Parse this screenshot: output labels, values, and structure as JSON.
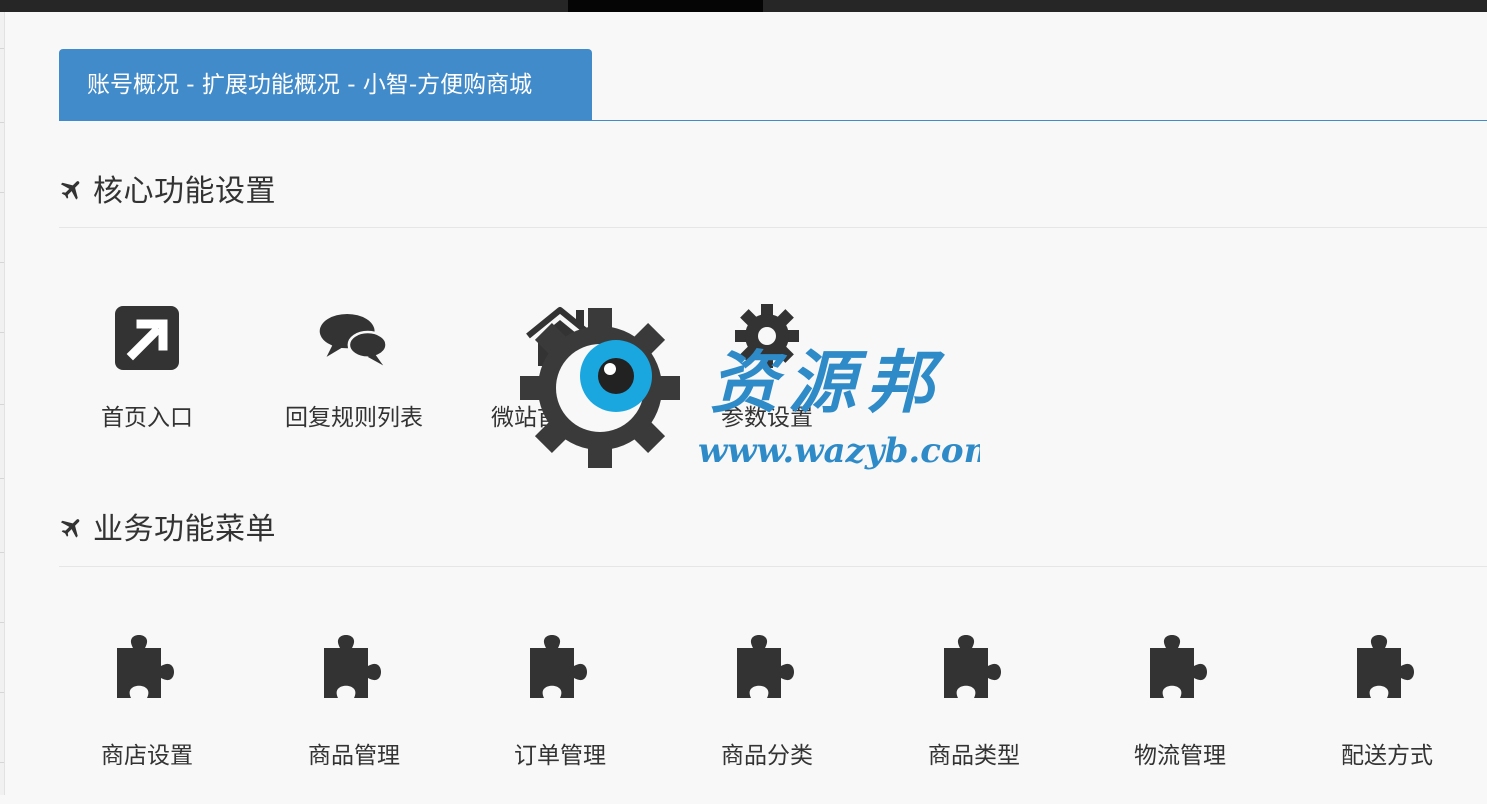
{
  "tab": {
    "title": "账号概况 - 扩展功能概况 - 小智-方便购商城"
  },
  "core": {
    "title": "核心功能设置",
    "items": [
      {
        "label": "首页入口",
        "icon": "external-link-icon"
      },
      {
        "label": "回复规则列表",
        "icon": "chat-bubbles-icon"
      },
      {
        "label": "微站首页导航",
        "icon": "home-icon"
      },
      {
        "label": "参数设置",
        "icon": "gear-icon"
      }
    ]
  },
  "business": {
    "title": "业务功能菜单",
    "items": [
      {
        "label": "商店设置",
        "icon": "puzzle-icon"
      },
      {
        "label": "商品管理",
        "icon": "puzzle-icon"
      },
      {
        "label": "订单管理",
        "icon": "puzzle-icon"
      },
      {
        "label": "商品分类",
        "icon": "puzzle-icon"
      },
      {
        "label": "商品类型",
        "icon": "puzzle-icon"
      },
      {
        "label": "物流管理",
        "icon": "puzzle-icon"
      },
      {
        "label": "配送方式",
        "icon": "puzzle-icon"
      }
    ]
  },
  "watermark": {
    "text": "资源邦",
    "url": "www.wazyb.com"
  },
  "colors": {
    "accent": "#428bca",
    "icon": "#333333",
    "page_bg": "#f8f8f8"
  }
}
